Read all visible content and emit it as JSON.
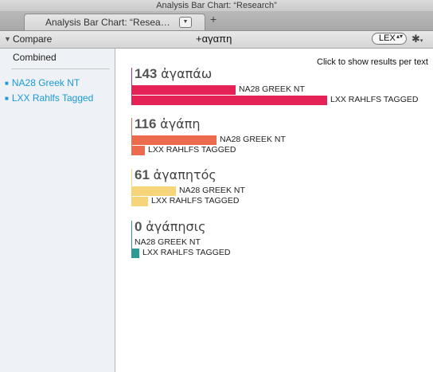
{
  "window": {
    "title": "Analysis Bar Chart: “Research”"
  },
  "tab": {
    "title": "Analysis Bar Chart: “Resea…",
    "menu_glyph": "▼",
    "new_tab_glyph": "+"
  },
  "toolbar": {
    "compare_label": "Compare",
    "search_term": "+αγαπη",
    "lex_label": "LEX",
    "lex_arrows": "▴▾",
    "gear_glyph": "✱",
    "gear_menu_glyph": "▾"
  },
  "sidebar": {
    "combined_label": "Combined",
    "items": [
      {
        "label": "NA28 Greek NT"
      },
      {
        "label": "LXX Rahlfs Tagged"
      }
    ]
  },
  "main": {
    "hint": "Click to show results per text"
  },
  "colors": {
    "group0": "#e52256",
    "group1": "#ec6b4f",
    "group2": "#f6d57a",
    "group3": "#2e9a96"
  },
  "chart_data": {
    "type": "bar",
    "groups": [
      {
        "count": "143",
        "word": "ἀγαπάω",
        "series": [
          {
            "name": "NA28 GREEK NT",
            "value": 110
          },
          {
            "name": "LXX RAHLFS TAGGED",
            "value": 206
          }
        ]
      },
      {
        "count": "116",
        "word": "ἀγάπη",
        "series": [
          {
            "name": "NA28 GREEK NT",
            "value": 90
          },
          {
            "name": "LXX RAHLFS TAGGED",
            "value": 14
          }
        ]
      },
      {
        "count": "61",
        "word": "ἀγαπητός",
        "series": [
          {
            "name": "NA28 GREEK NT",
            "value": 47
          },
          {
            "name": "LXX RAHLFS TAGGED",
            "value": 18
          }
        ]
      },
      {
        "count": "0",
        "word": "ἀγάπησις",
        "series": [
          {
            "name": "NA28 GREEK NT",
            "value": 0
          },
          {
            "name": "LXX RAHLFS TAGGED",
            "value": 8
          }
        ]
      }
    ]
  }
}
